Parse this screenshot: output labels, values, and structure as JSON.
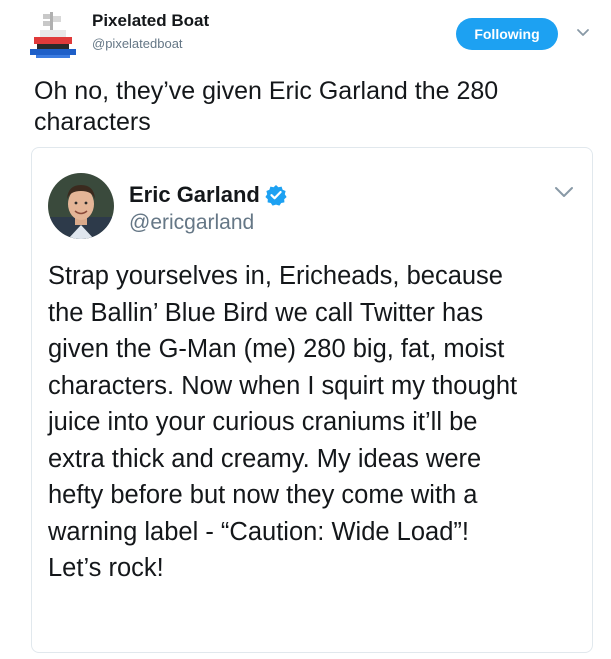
{
  "outer": {
    "display_name": "Pixelated Boat",
    "handle": "@pixelatedboat",
    "follow_label": "Following",
    "text": "Oh no, they’ve given Eric Garland the 280 characters",
    "avatar_icon": "pixel-boat-icon",
    "menu_icon": "chevron-down-icon"
  },
  "quoted": {
    "display_name": "Eric Garland",
    "handle": "@ericgarland",
    "verified_icon": "verified-badge-icon",
    "menu_icon": "chevron-down-icon",
    "text_lines": [
      "Strap yourselves in, Ericheads, because",
      "the Ballin’ Blue Bird we call Twitter has",
      "given the G-Man (me) 280 big, fat, moist",
      "characters. Now when I squirt my thought",
      "juice into your curious craniums it’ll be",
      "extra thick and creamy. My ideas were",
      "hefty before but now they come with a",
      "warning label - “Caution: Wide Load”!",
      "Let’s rock!"
    ]
  },
  "colors": {
    "accent": "#1da1f2",
    "text": "#14171a",
    "secondary_text": "#657786",
    "border": "#e1e8ed"
  }
}
